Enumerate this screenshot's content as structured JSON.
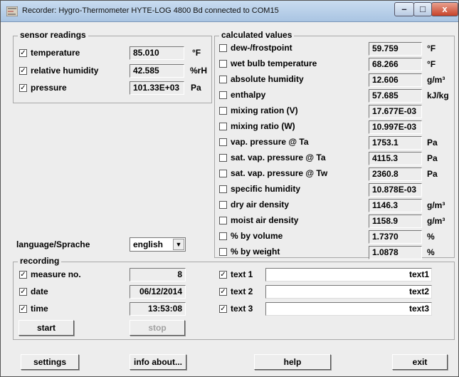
{
  "window": {
    "title": "Recorder: Hygro-Thermometer HYTE-LOG 4800 Bd connected to COM15"
  },
  "sensor_readings": {
    "title": "sensor readings",
    "items": [
      {
        "label": "temperature",
        "checked": "☑",
        "value": "85.010",
        "unit": "°F"
      },
      {
        "label": "relative humidity",
        "checked": "☑",
        "value": "42.585",
        "unit": "%rH"
      },
      {
        "label": "pressure",
        "checked": "☑",
        "value": "101.33E+03",
        "unit": "Pa"
      }
    ]
  },
  "calculated_values": {
    "title": "calculated values",
    "items": [
      {
        "label": "dew-/frostpoint",
        "value": "59.759",
        "unit": "°F"
      },
      {
        "label": "wet bulb temperature",
        "value": "68.266",
        "unit": "°F"
      },
      {
        "label": "absolute humidity",
        "value": "12.606",
        "unit": "g/m³"
      },
      {
        "label": "enthalpy",
        "value": "57.685",
        "unit": "kJ/kg"
      },
      {
        "label": "mixing ration (V)",
        "value": "17.677E-03",
        "unit": ""
      },
      {
        "label": "mixing ratio (W)",
        "value": "10.997E-03",
        "unit": ""
      },
      {
        "label": "vap. pressure @ Ta",
        "value": "1753.1",
        "unit": "Pa"
      },
      {
        "label": "sat. vap. pressure @ Ta",
        "value": "4115.3",
        "unit": "Pa"
      },
      {
        "label": "sat. vap. pressure @ Tw",
        "value": "2360.8",
        "unit": "Pa"
      },
      {
        "label": "specific humidity",
        "value": "10.878E-03",
        "unit": ""
      },
      {
        "label": "dry air density",
        "value": "1146.3",
        "unit": "g/m³"
      },
      {
        "label": "moist air density",
        "value": "1158.9",
        "unit": "g/m³"
      },
      {
        "label": "% by volume",
        "value": "1.7370",
        "unit": "%"
      },
      {
        "label": "% by weight",
        "value": "1.0878",
        "unit": "%"
      }
    ]
  },
  "language": {
    "label": "language/Sprache",
    "selected": "english"
  },
  "recording": {
    "title": "recording",
    "items": [
      {
        "label": "measure no.",
        "value": "8"
      },
      {
        "label": "date",
        "value": "06/12/2014"
      },
      {
        "label": "time",
        "value": "13:53:08"
      }
    ],
    "texts": [
      {
        "label": "text 1",
        "value": "text1"
      },
      {
        "label": "text 2",
        "value": "text2"
      },
      {
        "label": "text 3",
        "value": "text3"
      }
    ],
    "start_label": "start",
    "stop_label": "stop"
  },
  "bottom": {
    "settings_label": "settings",
    "info_label": "info about...",
    "help_label": "help",
    "exit_label": "exit"
  },
  "glyphs": {
    "check": "✓",
    "minimize": "–",
    "maximize": "□",
    "close": "x",
    "dropdown": "▼"
  }
}
